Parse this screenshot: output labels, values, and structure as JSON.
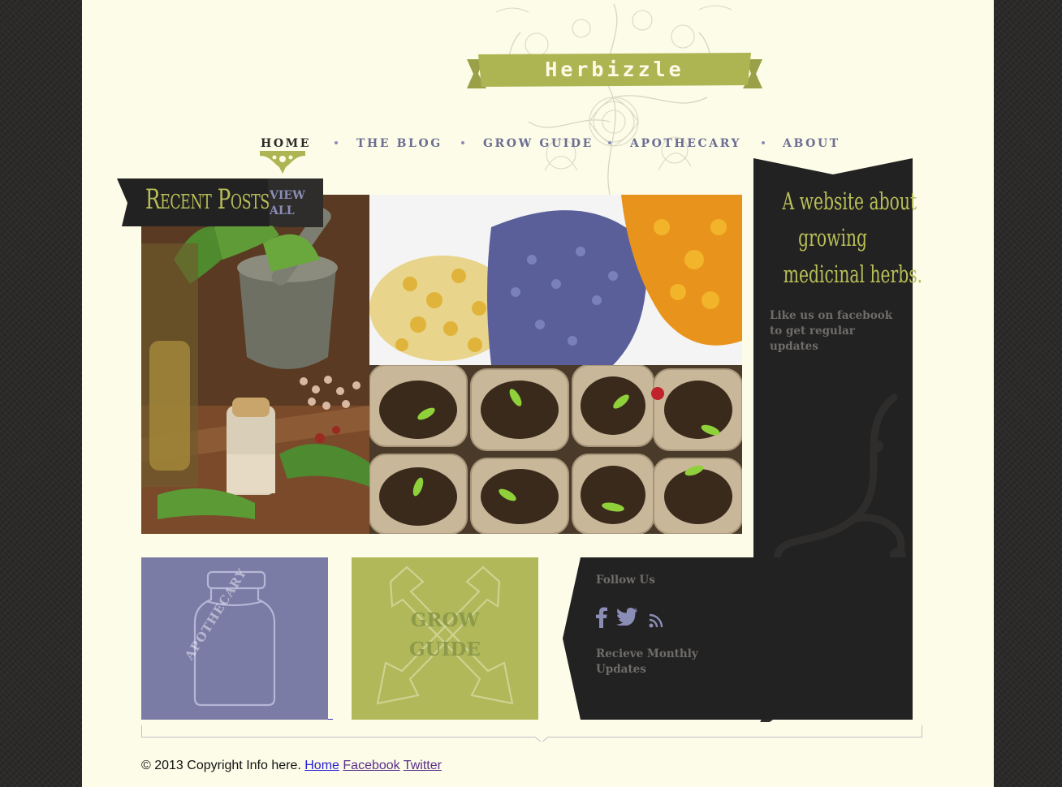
{
  "site": {
    "name": "Herbizzle"
  },
  "nav": {
    "items": [
      {
        "label": "Home",
        "active": true
      },
      {
        "label": "The Blog",
        "active": false
      },
      {
        "label": "Grow Guide",
        "active": false
      },
      {
        "label": "Apothecary",
        "active": false
      },
      {
        "label": "About",
        "active": false
      }
    ]
  },
  "recent_posts": {
    "title": "Recent Posts",
    "view_all": "View All"
  },
  "sidebar": {
    "tagline": [
      "A website about",
      "growing",
      "medicinal herbs."
    ],
    "facebook_prompt": "Like us on facebook to get regular updates"
  },
  "tiles": {
    "apothecary_label": "Apothecary",
    "grow_guide_label": [
      "Grow",
      "Guide"
    ]
  },
  "follow": {
    "title": "Follow Us",
    "icons": [
      "facebook-icon",
      "twitter-icon",
      "rss-icon"
    ],
    "newsletter": "Recieve Monthly Updates"
  },
  "footer": {
    "copyright": "© 2013 Copyright Info here.",
    "links": [
      "Home",
      "Facebook",
      "Twitter"
    ]
  },
  "colors": {
    "page_bg": "#fcfce8",
    "olive": "#b0b85a",
    "lavender": "#7a7ca6",
    "dark": "#232222",
    "nav_text": "#6b6d93"
  }
}
